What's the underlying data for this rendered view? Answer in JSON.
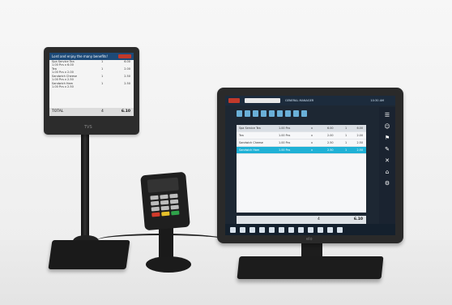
{
  "customer_display": {
    "header": "Lord and enjoy the many benefits!",
    "rows": [
      {
        "name": "Spa Service Tea",
        "detail": "1.00 Pcs x 6.00",
        "qty": "1",
        "price": "6.00"
      },
      {
        "name": "Tea",
        "detail": "1.00 Pcs x 2.00",
        "qty": "1",
        "price": "2.00"
      },
      {
        "name": "Sandwich Cheese",
        "detail": "1.00 Pcs x 2.50",
        "qty": "1",
        "price": "2.50"
      },
      {
        "name": "Sandwich Ham",
        "detail": "1.00 Pcs x 2.50",
        "qty": "1",
        "price": "2.50"
      }
    ],
    "total_label": "TOTAL",
    "total_qty": "4",
    "total_value": "6.10",
    "brand": "TVS"
  },
  "pos_terminal": {
    "logo_text": "TRIPAD",
    "title": "GENERAL MANAGER",
    "status": "10:30 AM",
    "quick_buttons": 9,
    "ticket_rows": [
      {
        "name": "Spa Service Tea",
        "qty": "1.00 Pcs",
        "x": "x",
        "price": "6.00",
        "n": "1",
        "total": "6.00",
        "style": "head"
      },
      {
        "name": "Tea",
        "qty": "1.00 Pcs",
        "x": "x",
        "price": "2.00",
        "n": "1",
        "total": "2.00",
        "style": ""
      },
      {
        "name": "Sandwich Cheese",
        "qty": "1.00 Pcs",
        "x": "x",
        "price": "2.50",
        "n": "1",
        "total": "2.50",
        "style": ""
      },
      {
        "name": "Sandwich Ham",
        "qty": "1.00 Pcs",
        "x": "x",
        "price": "2.50",
        "n": "1",
        "total": "2.50",
        "style": "sel"
      }
    ],
    "total_qty": "4",
    "total_value": "6.10",
    "sidebar_icons": [
      "receipt-icon",
      "user-icon",
      "tag-icon",
      "pen-icon",
      "trash-icon",
      "cart-icon",
      "gear-icon"
    ],
    "bottom_icons": 12,
    "brand": "elo"
  },
  "colors": {
    "accent": "#1fb1d6",
    "header_blue": "#1d4a78",
    "logo_red": "#c0392b"
  }
}
